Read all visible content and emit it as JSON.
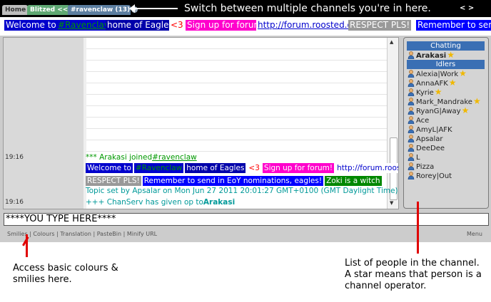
{
  "tabs": [
    {
      "label": "Home",
      "active": false,
      "bg": "#bdbdbd"
    },
    {
      "label": "Blitzed <<",
      "active": false,
      "bg": "#5fa873"
    },
    {
      "label": "#ravenclaw (13)",
      "active": true,
      "bg": "#5c7ea0",
      "close": "✕"
    }
  ],
  "annotations": {
    "switch_channels": "Switch between multiple channels you're in here.",
    "nav_arrows": "< >",
    "colours_smilies": [
      "Access basic colours &",
      "smilies here."
    ],
    "people_list": [
      "List of people in the channel.",
      "A star means that person is a",
      "channel operator."
    ]
  },
  "topic": [
    {
      "text": "Welcome to",
      "fg": "#ffffff",
      "bg": "#0000cc"
    },
    {
      "text": "#Ravenclaw",
      "fg": "#009900",
      "bg": "#0000cc",
      "underline": true
    },
    {
      "text": "home of Eagles",
      "fg": "#ffffff",
      "bg": "#0000aa"
    },
    {
      "text": "<3",
      "fg": "#ff0000",
      "bg": "#ffffff"
    },
    {
      "text": "Sign up for forum!",
      "fg": "#ffffff",
      "bg": "#ff00cc"
    },
    {
      "text": "http://forum.roosted.org/",
      "fg": "#0000cc",
      "bg": "#ffffff",
      "underline": true
    },
    {
      "text": "RESPECT PLS!",
      "fg": "#ffffff",
      "bg": "#999999"
    },
    {
      "text": "Remember to send in",
      "fg": "#ffffff",
      "bg": "#0000ff"
    }
  ],
  "messages": [
    {
      "time": "19:16",
      "text": "*** Arakasi joined ",
      "link": "#ravenclaw",
      "color": "#009900"
    },
    {
      "time": "19:16",
      "text": "Topic set by Apsalar on Mon Jun 27 2011 20:01:27 GMT+0100 (GMT Daylight Time)",
      "color": "#009999"
    },
    {
      "text": "+++ ChanServ has given op to ",
      "bold": "Arakasi",
      "color": "#009999"
    }
  ],
  "topic_repeat": {
    "row1": [
      {
        "text": "Welcome to ",
        "fg": "#ffffff",
        "bg": "#0000cc"
      },
      {
        "text": "#Ravenclaw",
        "fg": "#009900",
        "bg": "#0000cc"
      },
      {
        "text": "home of Eagles",
        "fg": "#ffffff",
        "bg": "#0000aa"
      },
      {
        "text": "<3",
        "fg": "#ff0000",
        "bg": "#ffffff"
      },
      {
        "text": "Sign up for forum!",
        "fg": "#ffffff",
        "bg": "#ff00cc"
      },
      {
        "text": "http://forum.roosted.org/",
        "fg": "#0000cc",
        "bg": "#ffffff"
      }
    ],
    "row2": [
      {
        "text": "RESPECT PLS!",
        "fg": "#ffffff",
        "bg": "#999999"
      },
      {
        "text": "Remember to send in EoY nominations, eagles!",
        "fg": "#ffffff",
        "bg": "#0000ff"
      },
      {
        "text": "Zoki is a witch",
        "fg": "#ffffff",
        "bg": "#008800"
      }
    ]
  },
  "nicklist": {
    "chatting_header": "Chatting",
    "idlers_header": "Idlers",
    "chatting": [
      {
        "nick": "Arakasi",
        "op": true
      }
    ],
    "idlers": [
      {
        "nick": "Alexia|Work",
        "op": true
      },
      {
        "nick": "AnnaAFK",
        "op": true
      },
      {
        "nick": "Kyrie",
        "op": true
      },
      {
        "nick": "Mark_Mandrake",
        "op": true
      },
      {
        "nick": "RyanG|Away",
        "op": true
      },
      {
        "nick": "Ace",
        "op": false
      },
      {
        "nick": "AmyL|AFK",
        "op": false
      },
      {
        "nick": "Apsalar",
        "op": false
      },
      {
        "nick": "DeeDee",
        "op": false
      },
      {
        "nick": "L",
        "op": false
      },
      {
        "nick": "Pizza",
        "op": false
      },
      {
        "nick": "Rorey|Out",
        "op": false
      }
    ]
  },
  "input": {
    "value": "****YOU TYPE HERE****"
  },
  "toolbar": {
    "items": [
      "Smilies",
      "Colours",
      "Translation",
      "PasteBin",
      "Minify URL"
    ],
    "separator": " | ",
    "menu": "Menu"
  },
  "colors": {
    "annotation_red": "#e00000",
    "header_blue": "#3a6fb4",
    "op_star": "#f0b800"
  }
}
